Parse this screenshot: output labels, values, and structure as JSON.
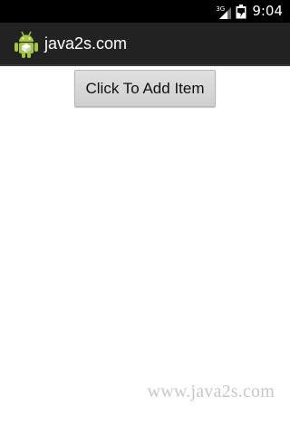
{
  "status_bar": {
    "network_label": "3G",
    "time": "9:04",
    "signal_icon": "signal-strength-icon",
    "battery_icon": "battery-icon"
  },
  "action_bar": {
    "app_icon": "android-robot-icon",
    "title": "java2s.com"
  },
  "main": {
    "add_button_label": "Click To Add Item"
  },
  "watermark": "www.java2s.com",
  "colors": {
    "status_bar_bg": "#000000",
    "action_bar_bg": "#222222",
    "android_green": "#a4c639",
    "button_bg": "#d6d6d6",
    "watermark": "#c8c8c8"
  }
}
